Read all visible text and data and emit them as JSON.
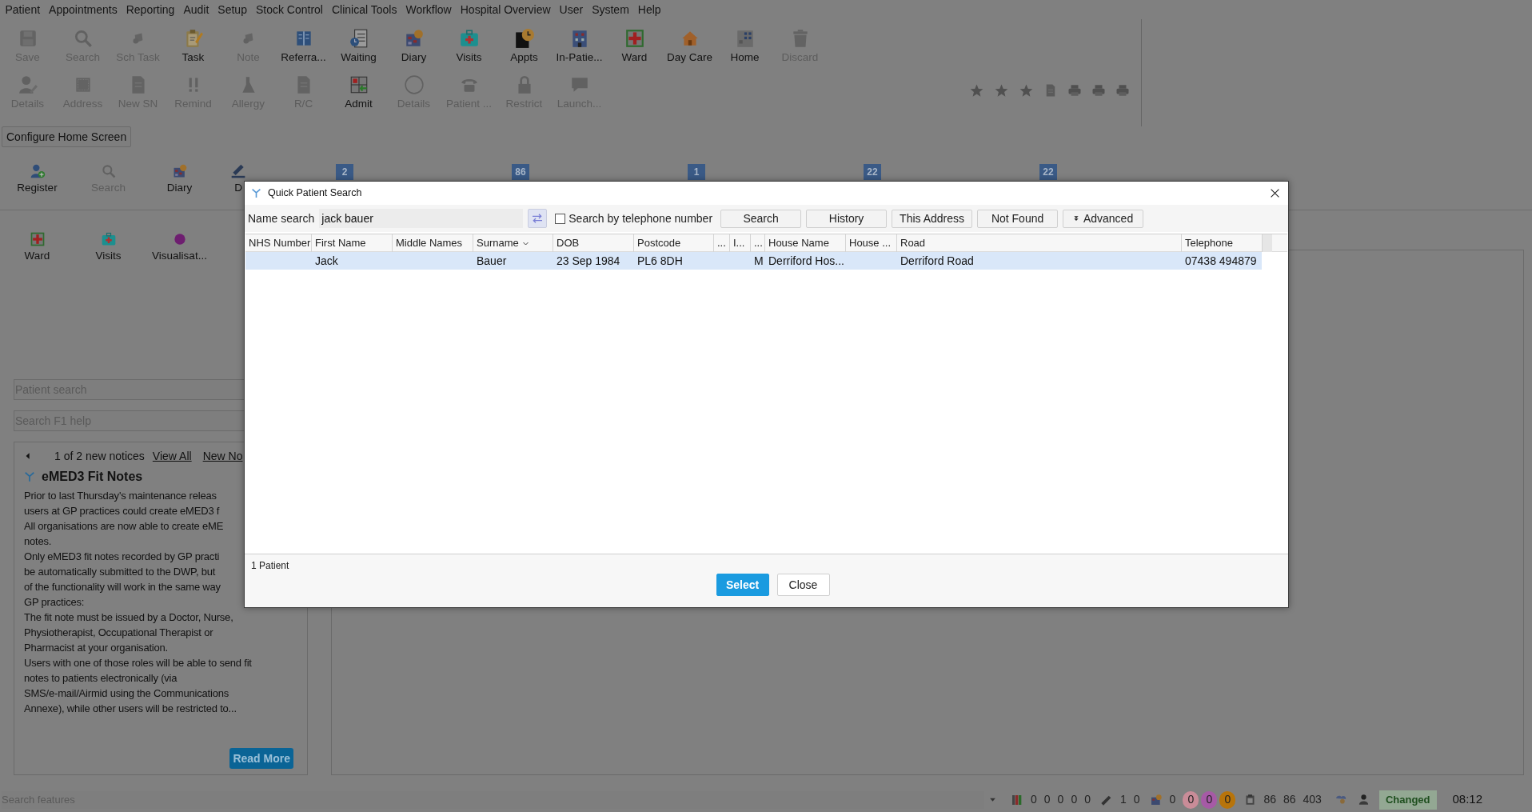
{
  "menu": [
    "Patient",
    "Appointments",
    "Reporting",
    "Audit",
    "Setup",
    "Stock Control",
    "Clinical Tools",
    "Workflow",
    "Hospital Overview",
    "User",
    "System",
    "Help"
  ],
  "toolbar": {
    "rows": [
      {
        "items": [
          {
            "label": "Save",
            "disabled": true
          },
          {
            "label": "Search",
            "disabled": true
          },
          {
            "label": "Sch Task",
            "disabled": true
          },
          {
            "label": "Task",
            "disabled": false
          },
          {
            "label": "Note",
            "disabled": true
          },
          {
            "label": "Referra...",
            "disabled": false
          },
          {
            "label": "Waiting",
            "disabled": false
          },
          {
            "label": "Diary",
            "disabled": false
          },
          {
            "label": "Visits",
            "disabled": false
          },
          {
            "label": "Appts",
            "disabled": false
          },
          {
            "label": "In-Patie...",
            "disabled": false
          },
          {
            "label": "Ward",
            "disabled": false
          },
          {
            "label": "Day Care",
            "disabled": false
          },
          {
            "label": "Home",
            "disabled": false
          },
          {
            "label": "Discard",
            "disabled": true
          }
        ]
      },
      {
        "items": [
          {
            "label": "Details",
            "disabled": true
          },
          {
            "label": "Address",
            "disabled": true
          },
          {
            "label": "New SN",
            "disabled": true
          },
          {
            "label": "Remind",
            "disabled": true
          },
          {
            "label": "Allergy",
            "disabled": true
          },
          {
            "label": "R/C",
            "disabled": true
          },
          {
            "label": "Admit",
            "disabled": false
          },
          {
            "label": "Details",
            "disabled": true
          },
          {
            "label": "Patient ...",
            "disabled": true
          },
          {
            "label": "Restrict",
            "disabled": true
          },
          {
            "label": "Launch...",
            "disabled": true
          }
        ]
      }
    ]
  },
  "configure_button": "Configure Home Screen",
  "home": {
    "launchers": [
      {
        "label": "Register",
        "disabled": false
      },
      {
        "label": "Search",
        "disabled": true
      },
      {
        "label": "Diary",
        "disabled": false
      },
      {
        "label": "D",
        "disabled": false
      }
    ],
    "badges": [
      "2",
      "86",
      "1",
      "22",
      "22"
    ],
    "launchers_2": [
      {
        "label": "Ward",
        "disabled": false
      },
      {
        "label": "Visits",
        "disabled": false
      },
      {
        "label": "Visualisat...",
        "disabled": false
      }
    ],
    "patient_search": {
      "placeholder": "Patient search"
    },
    "help_search": {
      "placeholder": "Search F1 help"
    },
    "notice": {
      "pager": "1 of 2 new notices",
      "links": [
        "View All",
        "New No"
      ],
      "title": "eMED3 Fit Notes",
      "paragraphs": [
        "Prior to last Thursday's maintenance releas\nusers at GP practices could create eMED3 f",
        "All organisations are now able to create eME\nnotes.",
        "Only eMED3 fit notes recorded by GP practi\nbe automatically submitted to the DWP, but\nof the functionality will work in the same way\nGP practices:",
        "The fit note must be issued by a Doctor, Nurse,\nPhysiotherapist, Occupational Therapist or\nPharmacist at your organisation.",
        "Users with one of those roles will be able to send fit\nnotes to patients electronically (via\nSMS/e-mail/Airmid using the Communications\nAnnexe), while other users will be restricted to..."
      ],
      "button": "Read More"
    }
  },
  "dialog": {
    "title": "Quick Patient Search",
    "name_search": {
      "label": "Name search",
      "value": "jack bauer"
    },
    "telephone_checkbox": {
      "label": "Search by telephone number",
      "checked": false
    },
    "buttons": [
      {
        "label": "Search",
        "kind": "plain"
      },
      {
        "label": "History",
        "kind": "plain"
      },
      {
        "label": "This Address",
        "kind": "plain"
      },
      {
        "label": "Not Found",
        "kind": "plain"
      },
      {
        "label": "Advanced",
        "kind": "dropdown"
      }
    ],
    "table": {
      "columns": [
        {
          "label": "NHS Number"
        },
        {
          "label": "First Name"
        },
        {
          "label": "Middle Names"
        },
        {
          "label": "Surname",
          "sorted": true
        },
        {
          "label": "DOB"
        },
        {
          "label": "Postcode"
        },
        {
          "label": "..."
        },
        {
          "label": "I..."
        },
        {
          "label": "..."
        },
        {
          "label": "House Name"
        },
        {
          "label": "House ..."
        },
        {
          "label": "Road"
        },
        {
          "label": "Telephone"
        }
      ],
      "rows": [
        {
          "selected": true,
          "cells": {
            "1": "Jack",
            "3": "Bauer",
            "4": "23 Sep 1984",
            "5": "PL6 8DH",
            "8": "M",
            "9": "Derriford Hos...",
            "11": "Derriford Road",
            "12": "07438 494879"
          }
        }
      ]
    },
    "count": "1 Patient",
    "footer_buttons": [
      {
        "label": "Select",
        "kind": "primary"
      },
      {
        "label": "Close",
        "kind": "secondary"
      }
    ]
  },
  "status_bar": {
    "search": {
      "placeholder": "Search features"
    },
    "counters": [
      {
        "values": [
          "0",
          "0",
          "0",
          "0",
          "0"
        ]
      },
      {
        "values": [
          "1",
          "0"
        ]
      },
      {
        "values": [
          "0"
        ]
      }
    ],
    "dots": [
      {
        "text": "0",
        "color": "#c98c98"
      },
      {
        "text": "0",
        "color": "#a65aa6"
      },
      {
        "text": "0",
        "color": "#b8740a"
      }
    ],
    "totals": [
      "86",
      "86",
      "403"
    ],
    "badge": "Changed",
    "time": "08:12"
  }
}
